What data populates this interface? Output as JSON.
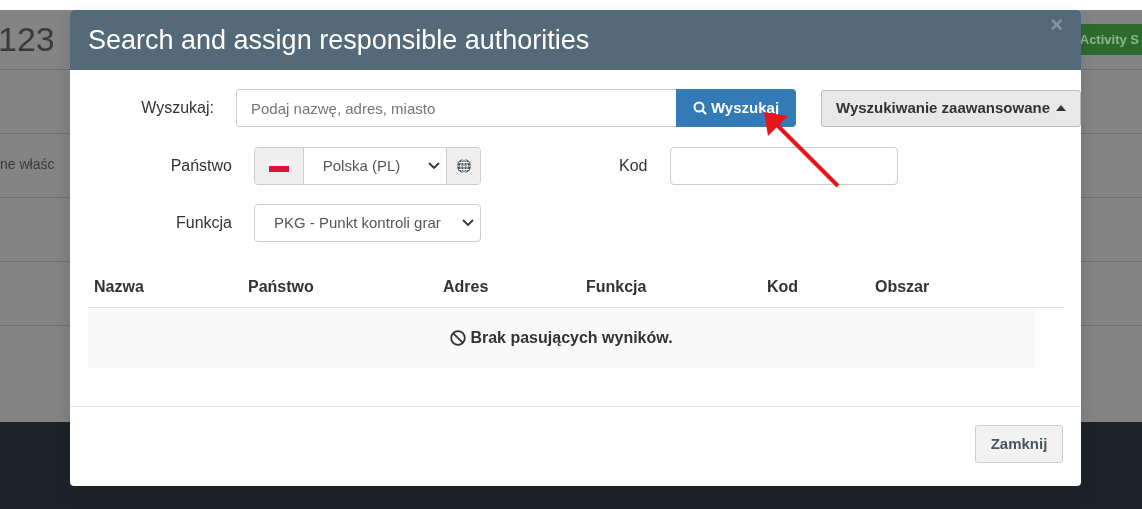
{
  "background": {
    "record_number": "123",
    "field_label": "ne właśc",
    "action_button": "Activity S"
  },
  "modal": {
    "title": "Search and assign responsible authorities",
    "close": "×",
    "search": {
      "label": "Wyszukaj:",
      "placeholder": "Podaj nazwę, adres, miasto",
      "button": "Wyszukaj"
    },
    "advanced_button": "Wyszukiwanie zaawansowane",
    "country": {
      "label": "Państwo",
      "value": "Polska (PL)"
    },
    "code": {
      "label": "Kod"
    },
    "function": {
      "label": "Funkcja",
      "value": "PKG - Punkt kontroli grar"
    },
    "table": {
      "columns": [
        "Nazwa",
        "Państwo",
        "Adres",
        "Funkcja",
        "Kod",
        "Obszar"
      ],
      "empty_message": "Brak pasujących wyników."
    },
    "footer_buttons": [
      "Zamknij"
    ]
  }
}
